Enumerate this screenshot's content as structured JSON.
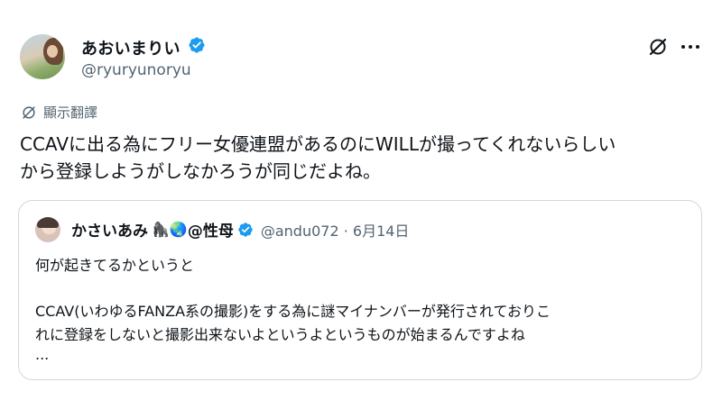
{
  "author": {
    "display_name": "あおいまりい",
    "handle": "@ryuryunoryu"
  },
  "translate": {
    "label": "顯示翻譯"
  },
  "tweet": {
    "lines": [
      "CCAVに出る為にフリー女優連盟があるのにWILLが撮ってくれないらしい",
      "から登録しようがしなかろうが同じだよね。"
    ]
  },
  "quoted": {
    "display_name": "かさいあみ",
    "emojis": "🦍🌏",
    "name_suffix": "@性母",
    "meta": "@andu072 · 6月14日",
    "lines": [
      "何が起きてるかというと",
      "CCAV(いわゆるFANZA系の撮影)をする為に謎マイナンバーが発行されておりこ",
      "れに登録をしないと撮影出来ないよというよというものが始まるんですよね",
      "..."
    ]
  },
  "colors": {
    "verified_blue": "#1d9bf0",
    "secondary_text": "#536471",
    "border": "#cfd9de"
  },
  "icons": [
    "verified-icon",
    "grok-icon",
    "more-icon",
    "translate-icon"
  ]
}
